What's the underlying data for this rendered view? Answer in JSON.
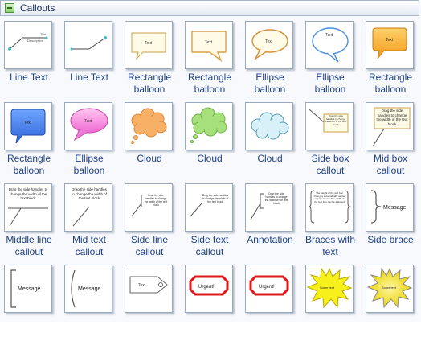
{
  "header": {
    "title": "Callouts",
    "icon": "callouts-stencil-icon"
  },
  "items": [
    {
      "label": "Line Text",
      "icon": "line-text-icon",
      "text": "Title",
      "subtext": "Description"
    },
    {
      "label": "Line Text",
      "icon": "line-text-icon"
    },
    {
      "label": "Rectangle balloon",
      "icon": "rectangle-balloon-icon",
      "text": "Text"
    },
    {
      "label": "Rectangle balloon",
      "icon": "rectangle-balloon-icon",
      "text": "Text"
    },
    {
      "label": "Ellipse balloon",
      "icon": "ellipse-balloon-icon",
      "text": "Text"
    },
    {
      "label": "Ellipse balloon",
      "icon": "ellipse-balloon-icon",
      "text": "Text"
    },
    {
      "label": "Rectangle balloon",
      "icon": "rectangle-balloon-icon",
      "text": "Text"
    },
    {
      "label": "Rectangle balloon",
      "icon": "rectangle-balloon-icon",
      "text": "Text"
    },
    {
      "label": "Ellipse balloon",
      "icon": "ellipse-balloon-icon",
      "text": "Text"
    },
    {
      "label": "Cloud",
      "icon": "cloud-icon"
    },
    {
      "label": "Cloud",
      "icon": "cloud-icon"
    },
    {
      "label": "Cloud",
      "icon": "cloud-icon"
    },
    {
      "label": "Side box callout",
      "icon": "side-box-callout-icon",
      "text": "Drag the side handles to change the width of the text block"
    },
    {
      "label": "Mid box callout",
      "icon": "mid-box-callout-icon",
      "text": "Drag the side handles to change the width of the text block"
    },
    {
      "label": "Middle line callout",
      "icon": "middle-line-callout-icon",
      "text": "Drag the side handles to change the width of the text block"
    },
    {
      "label": "Mid text callout",
      "icon": "mid-text-callout-icon",
      "text": "Drag the side handles to change the width of the text block"
    },
    {
      "label": "Side line callout",
      "icon": "side-line-callout-icon",
      "text": "Drag the side handles to change the width of the text block"
    },
    {
      "label": "Side text callout",
      "icon": "side-text-callout-icon",
      "text": "Drag the side handles to change the width of the text block"
    },
    {
      "label": "Annotation",
      "icon": "annotation-icon",
      "text": "Drag the side handles to change the width of the text block"
    },
    {
      "label": "Braces with text",
      "icon": "braces-with-text-icon",
      "text": "The height of the text box changes automatically as the text is entered. The width of the text box can be adjusted"
    },
    {
      "label": "Side brace",
      "icon": "side-brace-icon",
      "text": "Message"
    },
    {
      "label": "",
      "icon": "bracket-icon",
      "text": "Message"
    },
    {
      "label": "",
      "icon": "parenthesis-icon",
      "text": "Message"
    },
    {
      "label": "",
      "icon": "tag-icon",
      "text": "Text"
    },
    {
      "label": "",
      "icon": "urgent-badge-icon",
      "text": "Urgent!"
    },
    {
      "label": "",
      "icon": "urgent-badge-icon",
      "text": "Urgent!"
    },
    {
      "label": "",
      "icon": "starburst-icon",
      "text": "Some text"
    },
    {
      "label": "",
      "icon": "starburst-icon",
      "text": "Some text"
    }
  ]
}
